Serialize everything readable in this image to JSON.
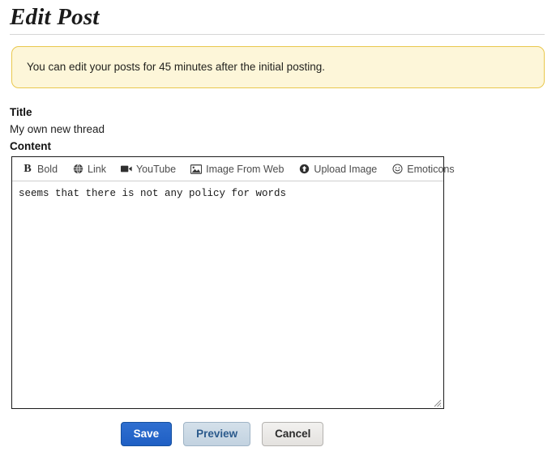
{
  "header": {
    "title": "Edit Post"
  },
  "notice": {
    "message": "You can edit your posts for 45 minutes after the initial posting.",
    "background_color": "#fdf6d9",
    "border_color": "#e9c84e"
  },
  "form": {
    "title_label": "Title",
    "title_value": "My own new thread",
    "content_label": "Content",
    "content_value": "seems that there is not any policy for words"
  },
  "toolbar": {
    "items": [
      {
        "label": "Bold",
        "icon": "bold-icon"
      },
      {
        "label": "Link",
        "icon": "globe-icon"
      },
      {
        "label": "YouTube",
        "icon": "video-camera-icon"
      },
      {
        "label": "Image From Web",
        "icon": "picture-icon"
      },
      {
        "label": "Upload Image",
        "icon": "upload-arrow-icon"
      },
      {
        "label": "Emoticons",
        "icon": "smiley-icon"
      }
    ]
  },
  "buttons": {
    "save": "Save",
    "preview": "Preview",
    "cancel": "Cancel",
    "save_color": "#1f5fc4",
    "preview_color": "#c2d2e0",
    "cancel_color": "#e4e2df"
  }
}
